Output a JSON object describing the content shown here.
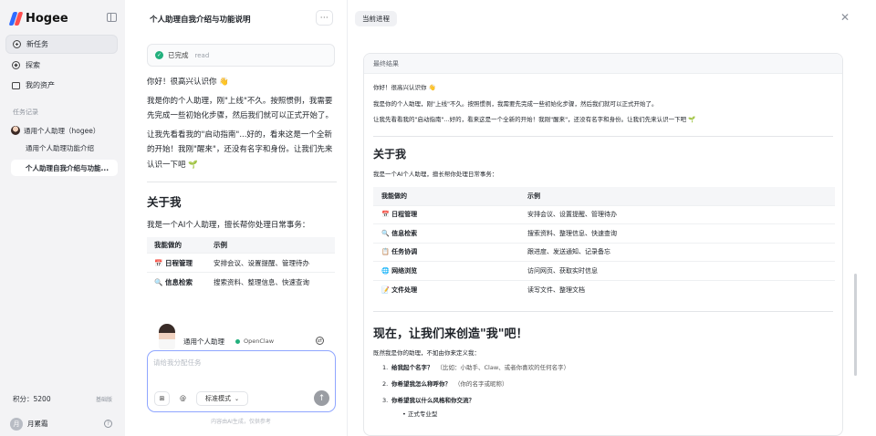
{
  "sidebar": {
    "brand": "Hogee",
    "nav": [
      {
        "label": "新任务",
        "icon": "plus-circle-icon"
      },
      {
        "label": "探索",
        "icon": "compass-icon"
      },
      {
        "label": "我的资产",
        "icon": "folder-icon"
      }
    ],
    "section_label": "任务记录",
    "history": [
      {
        "label": "通用个人助理（hogee）"
      },
      {
        "label": "通用个人助理功能介绍"
      },
      {
        "label": "个人助理自我介绍与功能..."
      }
    ],
    "points_label": "积分：5200",
    "points_badge": "基础版",
    "user_initial": "月",
    "user_name": "月累霜"
  },
  "chat": {
    "title": "个人助理自我介绍与功能说明",
    "more": "···",
    "status": "已完成",
    "status_sub": "read",
    "paragraphs": [
      "你好！很高兴认识你 👋",
      "我是你的个人助理，刚\"上线\"不久。按照惯例，我需要先完成一些初始化步骤，然后我们就可以正式开始了。",
      "让我先看看我的\"启动指南\"...好的，看来这是一个全新的开始！我刚\"醒来\"，还没有名字和身份。让我们先来认识一下吧 🌱"
    ],
    "about_heading": "关于我",
    "about_text": "我是一个AI个人助理，擅长帮你处理日常事务：",
    "table_headers": [
      "我能做的",
      "示例"
    ],
    "table_rows": [
      [
        "📅 日程管理",
        "安排会议、设置提醒、管理待办"
      ],
      [
        "🔍 信息检索",
        "搜索资料、整理信息、快速查询"
      ]
    ],
    "assistant_name": "通用个人助理",
    "assistant_model": "OpenClaw",
    "input_placeholder": "请给我分配任务",
    "mode_label": "标准模式",
    "disclaimer": "内容由AI生成，仅供参考"
  },
  "right": {
    "tab": "当前进程",
    "card_title": "最终结果",
    "intro": [
      "你好！很高兴认识你 👋",
      "我是你的个人助理，刚\"上线\"不久。按照惯例，我需要先完成一些初始化步骤，然后我们就可以正式开始了。",
      "让我先看看我的\"启动指南\"...好的，看来这是一个全新的开始！我刚\"醒来\"，还没有名字和身份。让我们先来认识一下吧 🌱"
    ],
    "about_heading": "关于我",
    "about_text": "我是一个AI个人助理，擅长帮你处理日常事务：",
    "table_headers": [
      "我能做的",
      "示例"
    ],
    "table_rows": [
      [
        "📅 日程管理",
        "安排会议、设置提醒、管理待办"
      ],
      [
        "🔍 信息检索",
        "搜索资料、整理信息、快速查询"
      ],
      [
        "📋 任务协调",
        "跟进度、发送通知、记录备忘"
      ],
      [
        "🌐 网络浏览",
        "访问网页、获取实时信息"
      ],
      [
        "📝 文件处理",
        "读写文件、整理文档"
      ]
    ],
    "create_heading": "现在，让我们来创造\"我\"吧！",
    "create_text": "既然我是你的助理，不如由你来定义我：",
    "questions": [
      {
        "num": "1.",
        "q": "给我起个名字？",
        "hint": "（比如：小助手、Claw、或者你喜欢的任何名字）"
      },
      {
        "num": "2.",
        "q": "你希望我怎么称呼你？",
        "hint": "（你的名字或昵称）"
      },
      {
        "num": "3.",
        "q": "你希望我以什么风格和你交流？",
        "hint": ""
      }
    ],
    "sub_bullet": "正式专业型"
  }
}
